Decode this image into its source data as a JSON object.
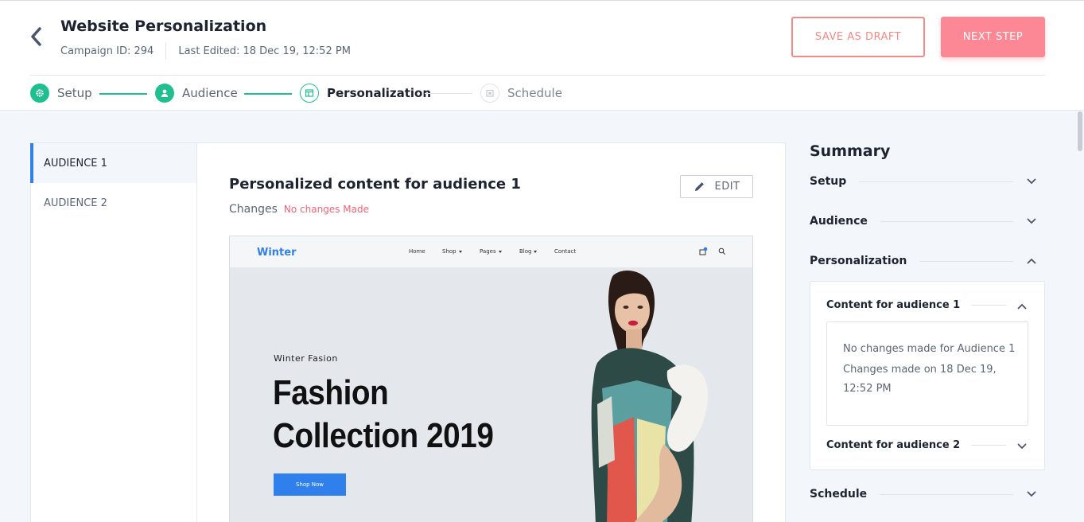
{
  "header": {
    "title": "Website Personalization",
    "campaign_id": "Campaign ID: 294",
    "last_edited": "Last Edited: 18 Dec 19, 12:52 PM",
    "save_draft_label": "SAVE AS DRAFT",
    "next_step_label": "NEXT STEP"
  },
  "steps": [
    {
      "label": "Setup",
      "status": "done",
      "icon": "gear-icon"
    },
    {
      "label": "Audience",
      "status": "done",
      "icon": "user-icon"
    },
    {
      "label": "Personalization",
      "status": "active",
      "icon": "layout-icon"
    },
    {
      "label": "Schedule",
      "status": "pending",
      "icon": "calendar-icon"
    }
  ],
  "audiences": [
    {
      "label": "AUDIENCE 1",
      "active": true
    },
    {
      "label": "AUDIENCE 2",
      "active": false
    }
  ],
  "main": {
    "title": "Personalized content for audience 1",
    "changes_label": "Changes",
    "changes_value": "No changes Made",
    "edit_label": "EDIT"
  },
  "preview": {
    "brand": "Winter",
    "menu": [
      "Home",
      "Shop",
      "Pages",
      "Blog",
      "Contact"
    ],
    "eyebrow": "Winter Fasion",
    "headline_line1": "Fashion",
    "headline_line2": "Collection 2019",
    "cta": "Shop Now"
  },
  "summary": {
    "title": "Summary",
    "sections": [
      "Setup",
      "Audience",
      "Personalization",
      "Schedule"
    ],
    "content1_label": "Content for audience 1",
    "content1_line1": "No changes made for Audience 1",
    "content1_line2": "Changes made on 18 Dec 19, 12:52 PM",
    "content2_label": "Content for audience 2"
  },
  "colors": {
    "accent_green": "#1fbf8f",
    "accent_pink": "#fc8896",
    "accent_blue": "#2f80ed",
    "warning_text": "#f0637a"
  }
}
